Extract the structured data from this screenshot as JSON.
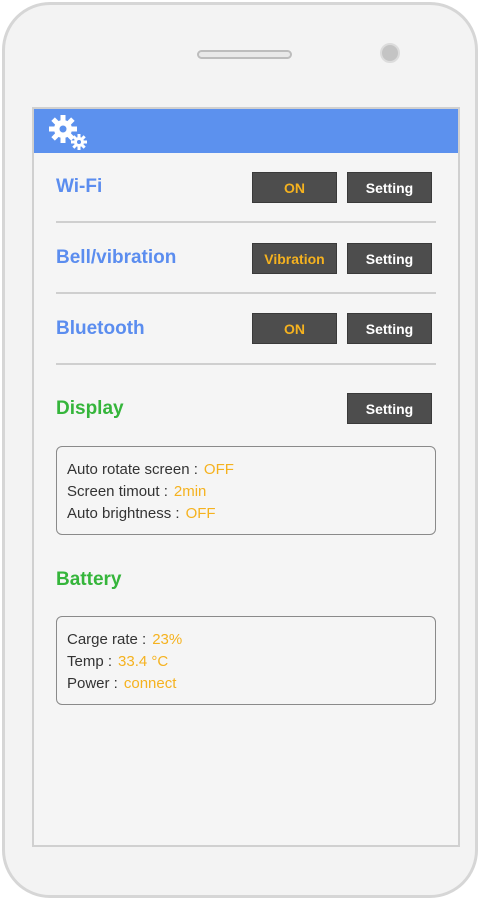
{
  "header": {
    "icon": "gear-icon"
  },
  "wifi": {
    "label": "Wi-Fi",
    "state": "ON",
    "setting": "Setting"
  },
  "bell": {
    "label": "Bell/vibration",
    "state": "Vibration",
    "setting": "Setting"
  },
  "bluetooth": {
    "label": "Bluetooth",
    "state": "ON",
    "setting": "Setting"
  },
  "display": {
    "label": "Display",
    "setting": "Setting",
    "items": [
      {
        "label": "Auto rotate screen :",
        "value": "OFF"
      },
      {
        "label": "Screen timout :",
        "value": "2min"
      },
      {
        "label": "Auto brightness :",
        "value": "OFF"
      }
    ]
  },
  "battery": {
    "label": "Battery",
    "items": [
      {
        "label": "Carge rate :",
        "value": "23%"
      },
      {
        "label": "Temp :",
        "value": "33.4 °C"
      },
      {
        "label": "Power :",
        "value": "connect"
      }
    ]
  },
  "colors": {
    "accent_blue": "#5b8def",
    "section_green": "#35b53b",
    "value_orange": "#f5b21f",
    "header_blue": "#5c91ee"
  }
}
